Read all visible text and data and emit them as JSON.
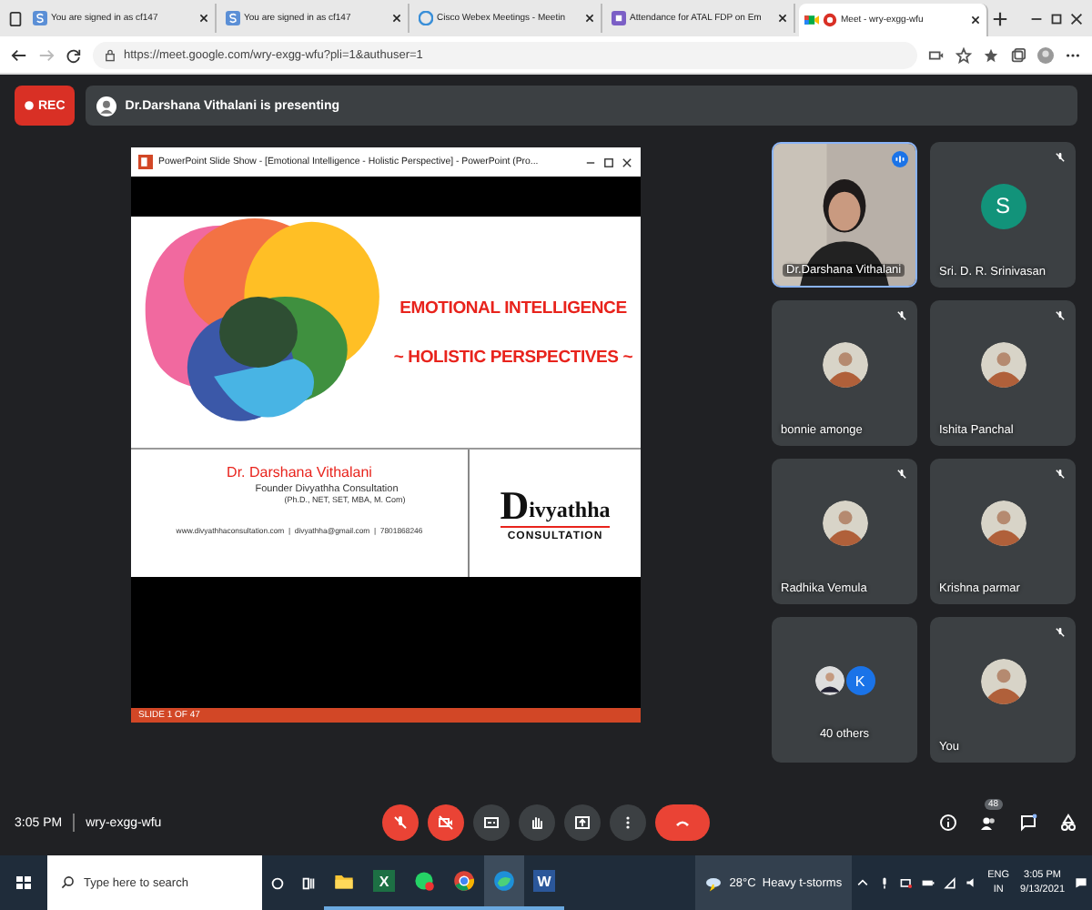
{
  "browser": {
    "tabs": [
      {
        "title": "You are signed in as cf147",
        "kind": "s",
        "selected": false
      },
      {
        "title": "You are signed in as cf147",
        "kind": "s",
        "selected": false
      },
      {
        "title": "Cisco Webex Meetings - Meetin",
        "kind": "webex",
        "selected": false
      },
      {
        "title": "Attendance for ATAL FDP on Em",
        "kind": "form",
        "selected": false
      },
      {
        "title": "Meet - wry-exgg-wfu",
        "kind": "meet",
        "selected": true
      }
    ],
    "url": "https://meet.google.com/wry-exgg-wfu?pli=1&authuser=1"
  },
  "meeting": {
    "rec_label": "REC",
    "presenting": "Dr.Darshana Vithalani is presenting"
  },
  "slide": {
    "window_title": "PowerPoint Slide Show - [Emotional Intelligence - Holistic Perspective] - PowerPoint (Pro...",
    "heading": "EMOTIONAL INTELLIGENCE",
    "subheading": "~ HOLISTIC PERSPECTIVES ~",
    "presenter_name": "Dr. Darshana Vithalani",
    "role": "Founder Divyathha Consultation",
    "credentials": "(Ph.D., NET, SET, MBA, M. Com)",
    "contacts": "www.divyathhaconsultation.com  |  divyathha@gmail.com  |  7801868246",
    "logo_initial": "D",
    "logo_rest": "ivyathha",
    "logo_sub": "CONSULTATION",
    "status": "SLIDE 1 OF 47"
  },
  "participants": [
    {
      "name": "Dr.Darshana Vithalani",
      "kind": "video",
      "speaking": true,
      "muted": false
    },
    {
      "name": "Sri. D. R. Srinivasan",
      "kind": "initial",
      "initial": "S",
      "color": "#12937a",
      "speaking": false,
      "muted": true
    },
    {
      "name": "bonnie amonge",
      "speaking": false,
      "muted": true
    },
    {
      "name": "Ishita Panchal",
      "speaking": false,
      "muted": true
    },
    {
      "name": "Radhika Vemula",
      "speaking": false,
      "muted": true
    },
    {
      "name": "Krishna parmar",
      "speaking": false,
      "muted": true
    },
    {
      "name": "40 others",
      "kind": "group",
      "initial": "K",
      "color": "#1a73e8",
      "speaking": false,
      "muted": false
    },
    {
      "name": "You",
      "speaking": false,
      "muted": true
    }
  ],
  "controls": {
    "time": "3:05 PM",
    "code": "wry-exgg-wfu",
    "buttons": [
      {
        "kind": "mic",
        "danger": true
      },
      {
        "kind": "camera",
        "danger": true
      },
      {
        "kind": "captions",
        "danger": false
      },
      {
        "kind": "hand",
        "danger": false
      },
      {
        "kind": "present",
        "danger": false
      },
      {
        "kind": "more",
        "danger": false
      },
      {
        "kind": "hangup",
        "danger": true
      }
    ],
    "people_count": "48"
  },
  "taskbar": {
    "search_placeholder": "Type here to search",
    "apps": [
      {
        "kind": "folder",
        "active": false
      },
      {
        "kind": "sheet",
        "letter": "X",
        "active": false
      },
      {
        "kind": "chat",
        "active": false
      },
      {
        "kind": "chrome",
        "active": false
      },
      {
        "kind": "edge",
        "active": true
      },
      {
        "kind": "doc",
        "letter": "W",
        "active": false
      }
    ],
    "weather": "28°C  Heavy t-storms",
    "lang": "ENG",
    "region": "IN",
    "time": "3:05 PM",
    "date": "9/13/2021"
  }
}
